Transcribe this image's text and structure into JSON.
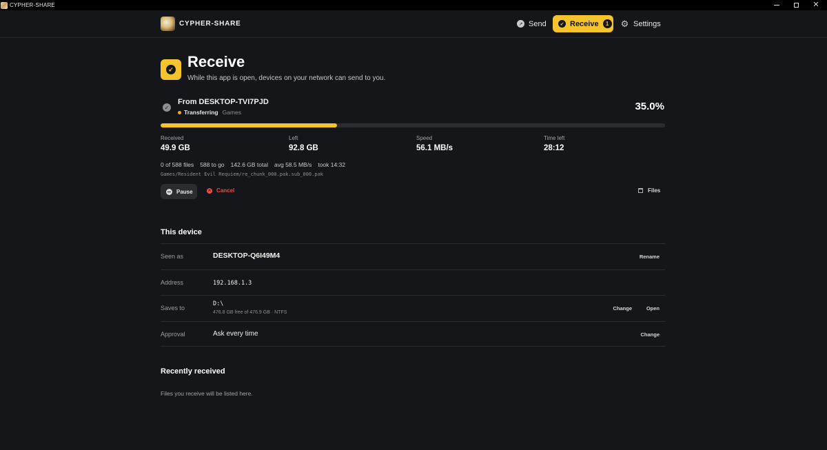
{
  "window": {
    "title": "CYPHER-SHARE"
  },
  "brand": {
    "name": "CYPHER-SHARE"
  },
  "nav": {
    "send": "Send",
    "receive": "Receive",
    "receive_badge": "1",
    "settings": "Settings"
  },
  "page": {
    "title": "Receive",
    "subtitle": "While this app is open, devices on your network can send to you."
  },
  "transfer": {
    "from": "From DESKTOP-TVI7PJD",
    "status": "Transferring",
    "category": "Games",
    "percent_text": "35.0%",
    "progress": 0.35,
    "stats": [
      {
        "label": "Received",
        "value": "49.9 GB"
      },
      {
        "label": "Left",
        "value": "92.8 GB"
      },
      {
        "label": "Speed",
        "value": "56.1 MB/s"
      },
      {
        "label": "Time left",
        "value": "28:12"
      }
    ],
    "meta": {
      "files": "0 of 588 files",
      "to_go": "588 to go",
      "total": "142.6 GB total",
      "avg": "avg 58.5 MB/s",
      "took": "took 14:32"
    },
    "current_file": "Games/Resident Evil Requiem/re_chunk_000.pak.sub_000.pak",
    "pause_label": "Pause",
    "cancel_label": "Cancel",
    "files_label": "Files"
  },
  "device": {
    "section_title": "This device",
    "seen_as_label": "Seen as",
    "seen_as_value": "DESKTOP-Q6I49M4",
    "rename_label": "Rename",
    "address_label": "Address",
    "address_value": "192.168.1.3",
    "saves_to_label": "Saves to",
    "saves_to_value": "D:\\",
    "saves_to_sub": "476.8 GB free of 476.9 GB · NTFS",
    "change_label": "Change",
    "open_label": "Open",
    "approval_label": "Approval",
    "approval_value": "Ask every time",
    "approval_change_label": "Change"
  },
  "recent": {
    "section_title": "Recently received",
    "empty_text": "Files you receive will be listed here."
  },
  "colors": {
    "accent": "#f5c32c",
    "background": "#151619",
    "danger": "#ef4a4a",
    "status_dot": "#f5a623"
  }
}
